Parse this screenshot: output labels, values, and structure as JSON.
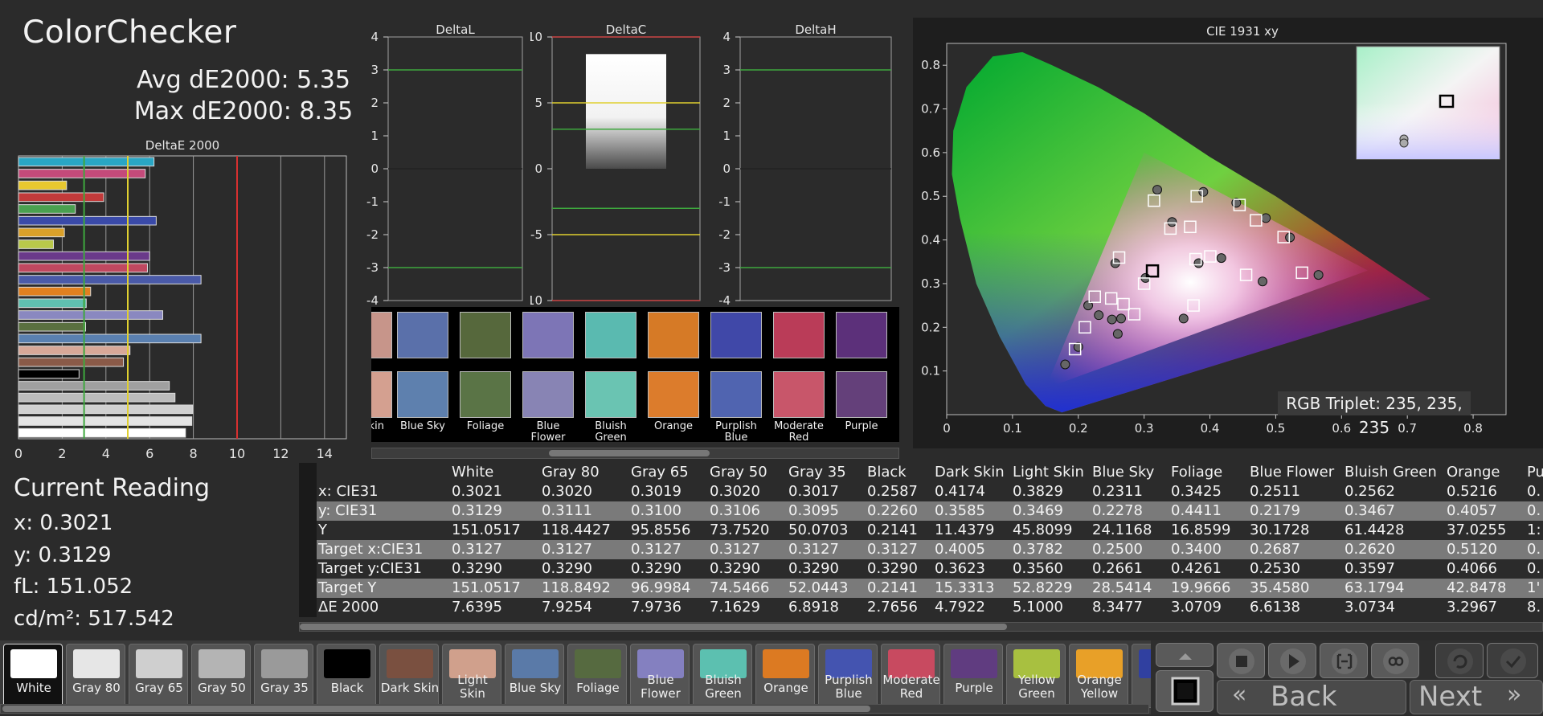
{
  "title": "ColorChecker",
  "avg": "Avg dE2000: 5.35",
  "max": "Max dE2000: 8.35",
  "delta_e_chart": {
    "title": "DeltaE 2000",
    "xticks": [
      "0",
      "2",
      "4",
      "6",
      "8",
      "10",
      "12",
      "14"
    ],
    "xlim": [
      0,
      15
    ],
    "green_line": 3,
    "yellow_line": 5,
    "red_line": 10,
    "bars": [
      {
        "v": 6.2,
        "c": "#29a6c4"
      },
      {
        "v": 5.8,
        "c": "#c44a7a"
      },
      {
        "v": 2.2,
        "c": "#e8c830"
      },
      {
        "v": 3.9,
        "c": "#c23a3a"
      },
      {
        "v": 2.6,
        "c": "#4aa050"
      },
      {
        "v": 6.3,
        "c": "#3a4aa8"
      },
      {
        "v": 2.1,
        "c": "#d9a02a"
      },
      {
        "v": 1.6,
        "c": "#b9c84a"
      },
      {
        "v": 6.0,
        "c": "#6a3a8a"
      },
      {
        "v": 5.9,
        "c": "#c04860"
      },
      {
        "v": 8.35,
        "c": "#4a5aa8"
      },
      {
        "v": 3.3,
        "c": "#e08020"
      },
      {
        "v": 3.1,
        "c": "#60c0b0"
      },
      {
        "v": 6.6,
        "c": "#8a88c0"
      },
      {
        "v": 3.07,
        "c": "#5a7040"
      },
      {
        "v": 8.35,
        "c": "#5a80b0"
      },
      {
        "v": 5.1,
        "c": "#d8a898"
      },
      {
        "v": 4.8,
        "c": "#8a5a48"
      },
      {
        "v": 2.77,
        "c": "#000000"
      },
      {
        "v": 6.9,
        "c": "#a0a0a0"
      },
      {
        "v": 7.16,
        "c": "#bcbcbc"
      },
      {
        "v": 7.97,
        "c": "#d0d0d0"
      },
      {
        "v": 7.93,
        "c": "#e4e4e4"
      },
      {
        "v": 7.64,
        "c": "#ffffff"
      }
    ]
  },
  "small_charts": {
    "deltaL": {
      "title": "DeltaL",
      "yticks": [
        "4",
        "3",
        "2",
        "1",
        "0",
        "-1",
        "-2",
        "-3",
        "-4"
      ]
    },
    "deltaC": {
      "title": "DeltaC",
      "yticks": [
        "10",
        "5",
        "0",
        "-5",
        "-10"
      ],
      "bar_top": 8.7
    },
    "deltaH": {
      "title": "DeltaH",
      "yticks": [
        "4",
        "3",
        "2",
        "1",
        "0",
        "-1",
        "-2",
        "-3",
        "-4"
      ]
    }
  },
  "cie": {
    "title": "CIE 1931 xy",
    "xticks": [
      "0",
      "0.1",
      "0.2",
      "0.3",
      "0.4",
      "0.5",
      "0.6",
      "0.7",
      "0.8"
    ],
    "yticks": [
      "0.8",
      "0.7",
      "0.6",
      "0.5",
      "0.4",
      "0.3",
      "0.2",
      "0.1",
      "0"
    ],
    "rgb_triplet": "RGB Triplet: 235, 235, 235",
    "targets": [
      [
        0.3127,
        0.329
      ],
      [
        0.4005,
        0.3623
      ],
      [
        0.3782,
        0.356
      ],
      [
        0.25,
        0.2661
      ],
      [
        0.34,
        0.4261
      ],
      [
        0.2687,
        0.253
      ],
      [
        0.262,
        0.3597
      ],
      [
        0.512,
        0.4066
      ],
      [
        0.21,
        0.2
      ],
      [
        0.455,
        0.32
      ],
      [
        0.225,
        0.27
      ],
      [
        0.38,
        0.5
      ],
      [
        0.315,
        0.49
      ],
      [
        0.47,
        0.445
      ],
      [
        0.195,
        0.15
      ],
      [
        0.37,
        0.43
      ],
      [
        0.445,
        0.48
      ],
      [
        0.3,
        0.3
      ],
      [
        0.375,
        0.25
      ],
      [
        0.285,
        0.23
      ],
      [
        0.54,
        0.325
      ]
    ],
    "measured": [
      [
        0.3021,
        0.3129
      ],
      [
        0.4174,
        0.3585
      ],
      [
        0.3829,
        0.3469
      ],
      [
        0.2311,
        0.2278
      ],
      [
        0.3425,
        0.4411
      ],
      [
        0.2511,
        0.2179
      ],
      [
        0.2562,
        0.3467
      ],
      [
        0.5216,
        0.4057
      ],
      [
        0.2,
        0.155
      ],
      [
        0.48,
        0.305
      ],
      [
        0.215,
        0.25
      ],
      [
        0.39,
        0.51
      ],
      [
        0.32,
        0.515
      ],
      [
        0.485,
        0.45
      ],
      [
        0.18,
        0.115
      ],
      [
        0.565,
        0.32
      ],
      [
        0.44,
        0.485
      ],
      [
        0.36,
        0.22
      ],
      [
        0.26,
        0.185
      ],
      [
        0.265,
        0.22
      ]
    ]
  },
  "swatches": {
    "top": [
      "#c7958a",
      "#5a70aa",
      "#56683c",
      "#7d75b6",
      "#5abab0",
      "#d67a26",
      "#4048a8",
      "#ba3c58",
      "#5c307a"
    ],
    "bottom": [
      "#d4a090",
      "#5e80ae",
      "#5a7446",
      "#8884b4",
      "#6ac4b2",
      "#dc7c2c",
      "#5064b0",
      "#c8566a",
      "#64407a"
    ],
    "labels": [
      "kin",
      "Blue Sky",
      "Foliage",
      "Blue Flower",
      "Bluish Green",
      "Orange",
      "Purplish Blue",
      "Moderate Red",
      "Purple"
    ]
  },
  "current": {
    "title": "Current Reading",
    "x": "x: 0.3021",
    "y": "y: 0.3129",
    "fL": "fL: 151.052",
    "cd": "cd/m²: 517.542"
  },
  "table": {
    "columns": [
      "White",
      "Gray 80",
      "Gray 65",
      "Gray 50",
      "Gray 35",
      "Black",
      "Dark Skin",
      "Light Skin",
      "Blue Sky",
      "Foliage",
      "Blue Flower",
      "Bluish Green",
      "Orange",
      "Pu"
    ],
    "rows": [
      {
        "label": "x: CIE31",
        "vals": [
          "0.3021",
          "0.3020",
          "0.3019",
          "0.3020",
          "0.3017",
          "0.2587",
          "0.4174",
          "0.3829",
          "0.2311",
          "0.3425",
          "0.2511",
          "0.2562",
          "0.5216",
          "0."
        ]
      },
      {
        "label": "y: CIE31",
        "vals": [
          "0.3129",
          "0.3111",
          "0.3100",
          "0.3106",
          "0.3095",
          "0.2260",
          "0.3585",
          "0.3469",
          "0.2278",
          "0.4411",
          "0.2179",
          "0.3467",
          "0.4057",
          "0."
        ]
      },
      {
        "label": "Y",
        "vals": [
          "151.0517",
          "118.4427",
          "95.8556",
          "73.7520",
          "50.0703",
          "0.2141",
          "11.4379",
          "45.8099",
          "24.1168",
          "16.8599",
          "30.1728",
          "61.4428",
          "37.0255",
          "1:"
        ]
      },
      {
        "label": "Target x:CIE31",
        "vals": [
          "0.3127",
          "0.3127",
          "0.3127",
          "0.3127",
          "0.3127",
          "0.3127",
          "0.4005",
          "0.3782",
          "0.2500",
          "0.3400",
          "0.2687",
          "0.2620",
          "0.5120",
          "0."
        ]
      },
      {
        "label": "Target y:CIE31",
        "vals": [
          "0.3290",
          "0.3290",
          "0.3290",
          "0.3290",
          "0.3290",
          "0.3290",
          "0.3623",
          "0.3560",
          "0.2661",
          "0.4261",
          "0.2530",
          "0.3597",
          "0.4066",
          "0."
        ]
      },
      {
        "label": "Target Y",
        "vals": [
          "151.0517",
          "118.8492",
          "96.9984",
          "74.5466",
          "52.0443",
          "0.2141",
          "15.3313",
          "52.8229",
          "28.5414",
          "19.9666",
          "35.4580",
          "63.1794",
          "42.8478",
          "1'"
        ]
      },
      {
        "label": "ΔE 2000",
        "vals": [
          "7.6395",
          "7.9254",
          "7.9736",
          "7.1629",
          "6.8918",
          "2.7656",
          "4.7922",
          "5.1000",
          "8.3477",
          "3.0709",
          "6.6138",
          "3.0734",
          "3.2967",
          "8."
        ]
      }
    ]
  },
  "bottom_tiles": [
    {
      "label": "White",
      "color": "#ffffff",
      "selected": true
    },
    {
      "label": "Gray 80",
      "color": "#e6e6e6"
    },
    {
      "label": "Gray 65",
      "color": "#cfcfcf"
    },
    {
      "label": "Gray 50",
      "color": "#b4b4b4"
    },
    {
      "label": "Gray 35",
      "color": "#9a9a9a"
    },
    {
      "label": "Black",
      "color": "#000000"
    },
    {
      "label": "Dark Skin",
      "color": "#7a5040"
    },
    {
      "label": "Light Skin",
      "color": "#d0a08c"
    },
    {
      "label": "Blue Sky",
      "color": "#5a7aa8"
    },
    {
      "label": "Foliage",
      "color": "#566a40"
    },
    {
      "label": "Blue Flower",
      "color": "#8480c0"
    },
    {
      "label": "Bluish Green",
      "color": "#5cc0b0"
    },
    {
      "label": "Orange",
      "color": "#dc7a22"
    },
    {
      "label": "Purplish Blue",
      "color": "#4454b0"
    },
    {
      "label": "Moderate Red",
      "color": "#c84a60"
    },
    {
      "label": "Purple",
      "color": "#603c80"
    },
    {
      "label": "Yellow Green",
      "color": "#a8c040"
    },
    {
      "label": "Orange Yellow",
      "color": "#e8a028"
    },
    {
      "label": "",
      "color": "#3040a0"
    }
  ],
  "nav": {
    "back": "Back",
    "next": "Next"
  }
}
